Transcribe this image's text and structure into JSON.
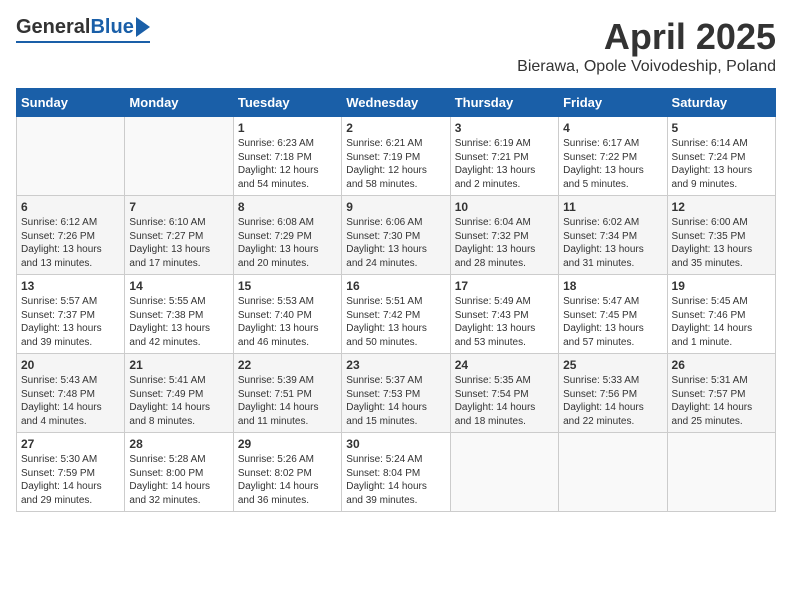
{
  "header": {
    "logo_general": "General",
    "logo_blue": "Blue",
    "month": "April 2025",
    "location": "Bierawa, Opole Voivodeship, Poland"
  },
  "weekdays": [
    "Sunday",
    "Monday",
    "Tuesday",
    "Wednesday",
    "Thursday",
    "Friday",
    "Saturday"
  ],
  "weeks": [
    [
      {
        "day": "",
        "content": ""
      },
      {
        "day": "",
        "content": ""
      },
      {
        "day": "1",
        "content": "Sunrise: 6:23 AM\nSunset: 7:18 PM\nDaylight: 12 hours\nand 54 minutes."
      },
      {
        "day": "2",
        "content": "Sunrise: 6:21 AM\nSunset: 7:19 PM\nDaylight: 12 hours\nand 58 minutes."
      },
      {
        "day": "3",
        "content": "Sunrise: 6:19 AM\nSunset: 7:21 PM\nDaylight: 13 hours\nand 2 minutes."
      },
      {
        "day": "4",
        "content": "Sunrise: 6:17 AM\nSunset: 7:22 PM\nDaylight: 13 hours\nand 5 minutes."
      },
      {
        "day": "5",
        "content": "Sunrise: 6:14 AM\nSunset: 7:24 PM\nDaylight: 13 hours\nand 9 minutes."
      }
    ],
    [
      {
        "day": "6",
        "content": "Sunrise: 6:12 AM\nSunset: 7:26 PM\nDaylight: 13 hours\nand 13 minutes."
      },
      {
        "day": "7",
        "content": "Sunrise: 6:10 AM\nSunset: 7:27 PM\nDaylight: 13 hours\nand 17 minutes."
      },
      {
        "day": "8",
        "content": "Sunrise: 6:08 AM\nSunset: 7:29 PM\nDaylight: 13 hours\nand 20 minutes."
      },
      {
        "day": "9",
        "content": "Sunrise: 6:06 AM\nSunset: 7:30 PM\nDaylight: 13 hours\nand 24 minutes."
      },
      {
        "day": "10",
        "content": "Sunrise: 6:04 AM\nSunset: 7:32 PM\nDaylight: 13 hours\nand 28 minutes."
      },
      {
        "day": "11",
        "content": "Sunrise: 6:02 AM\nSunset: 7:34 PM\nDaylight: 13 hours\nand 31 minutes."
      },
      {
        "day": "12",
        "content": "Sunrise: 6:00 AM\nSunset: 7:35 PM\nDaylight: 13 hours\nand 35 minutes."
      }
    ],
    [
      {
        "day": "13",
        "content": "Sunrise: 5:57 AM\nSunset: 7:37 PM\nDaylight: 13 hours\nand 39 minutes."
      },
      {
        "day": "14",
        "content": "Sunrise: 5:55 AM\nSunset: 7:38 PM\nDaylight: 13 hours\nand 42 minutes."
      },
      {
        "day": "15",
        "content": "Sunrise: 5:53 AM\nSunset: 7:40 PM\nDaylight: 13 hours\nand 46 minutes."
      },
      {
        "day": "16",
        "content": "Sunrise: 5:51 AM\nSunset: 7:42 PM\nDaylight: 13 hours\nand 50 minutes."
      },
      {
        "day": "17",
        "content": "Sunrise: 5:49 AM\nSunset: 7:43 PM\nDaylight: 13 hours\nand 53 minutes."
      },
      {
        "day": "18",
        "content": "Sunrise: 5:47 AM\nSunset: 7:45 PM\nDaylight: 13 hours\nand 57 minutes."
      },
      {
        "day": "19",
        "content": "Sunrise: 5:45 AM\nSunset: 7:46 PM\nDaylight: 14 hours\nand 1 minute."
      }
    ],
    [
      {
        "day": "20",
        "content": "Sunrise: 5:43 AM\nSunset: 7:48 PM\nDaylight: 14 hours\nand 4 minutes."
      },
      {
        "day": "21",
        "content": "Sunrise: 5:41 AM\nSunset: 7:49 PM\nDaylight: 14 hours\nand 8 minutes."
      },
      {
        "day": "22",
        "content": "Sunrise: 5:39 AM\nSunset: 7:51 PM\nDaylight: 14 hours\nand 11 minutes."
      },
      {
        "day": "23",
        "content": "Sunrise: 5:37 AM\nSunset: 7:53 PM\nDaylight: 14 hours\nand 15 minutes."
      },
      {
        "day": "24",
        "content": "Sunrise: 5:35 AM\nSunset: 7:54 PM\nDaylight: 14 hours\nand 18 minutes."
      },
      {
        "day": "25",
        "content": "Sunrise: 5:33 AM\nSunset: 7:56 PM\nDaylight: 14 hours\nand 22 minutes."
      },
      {
        "day": "26",
        "content": "Sunrise: 5:31 AM\nSunset: 7:57 PM\nDaylight: 14 hours\nand 25 minutes."
      }
    ],
    [
      {
        "day": "27",
        "content": "Sunrise: 5:30 AM\nSunset: 7:59 PM\nDaylight: 14 hours\nand 29 minutes."
      },
      {
        "day": "28",
        "content": "Sunrise: 5:28 AM\nSunset: 8:00 PM\nDaylight: 14 hours\nand 32 minutes."
      },
      {
        "day": "29",
        "content": "Sunrise: 5:26 AM\nSunset: 8:02 PM\nDaylight: 14 hours\nand 36 minutes."
      },
      {
        "day": "30",
        "content": "Sunrise: 5:24 AM\nSunset: 8:04 PM\nDaylight: 14 hours\nand 39 minutes."
      },
      {
        "day": "",
        "content": ""
      },
      {
        "day": "",
        "content": ""
      },
      {
        "day": "",
        "content": ""
      }
    ]
  ]
}
